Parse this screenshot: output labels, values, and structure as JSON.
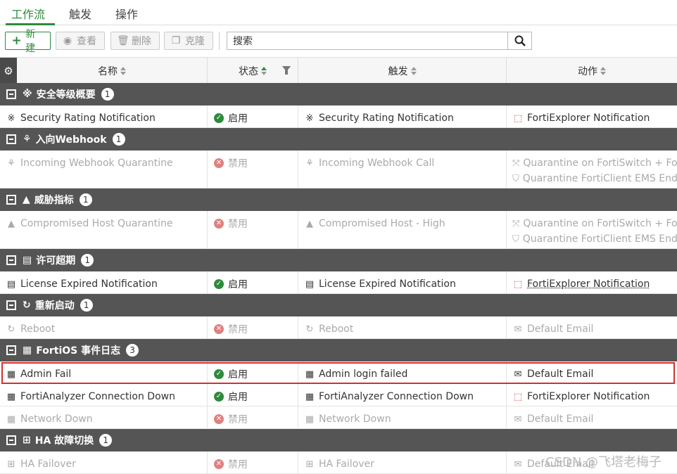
{
  "tabs": [
    "工作流",
    "触发",
    "操作"
  ],
  "toolbar": {
    "new": "新建",
    "view": "查看",
    "delete": "删除",
    "clone": "克隆",
    "search_placeholder": "搜索"
  },
  "columns": [
    "名称",
    "状态",
    "触发",
    "动作"
  ],
  "groups": [
    {
      "label": "安全等级概要",
      "count": "1",
      "icon": "security-rating-icon"
    },
    {
      "label": "入向Webhook",
      "count": "1",
      "icon": "webhook-icon"
    },
    {
      "label": "威胁指标",
      "count": "1",
      "icon": "warning-icon"
    },
    {
      "label": "许可超期",
      "count": "1",
      "icon": "license-icon"
    },
    {
      "label": "重新启动",
      "count": "1",
      "icon": "reboot-icon"
    },
    {
      "label": "FortiOS 事件日志",
      "count": "3",
      "icon": "event-log-icon"
    },
    {
      "label": "HA 故障切换",
      "count": "1",
      "icon": "ha-icon"
    }
  ],
  "rows": [
    {
      "name": "Security Rating Notification",
      "status": "启用",
      "trigger": "Security Rating Notification",
      "actions": [
        "FortiExplorer Notification"
      ]
    },
    {
      "name": "Incoming Webhook Quarantine",
      "status": "禁用",
      "trigger": "Incoming Webhook Call",
      "actions": [
        "Quarantine on FortiSwitch + FortiAP",
        "Quarantine FortiClient EMS Endpoint"
      ]
    },
    {
      "name": "Compromised Host Quarantine",
      "status": "禁用",
      "trigger": "Compromised Host - High",
      "actions": [
        "Quarantine on FortiSwitch + FortiAP",
        "Quarantine FortiClient EMS Endpoint"
      ]
    },
    {
      "name": "License Expired Notification",
      "status": "启用",
      "trigger": "License Expired Notification",
      "actions": [
        "FortiExplorer Notification"
      ]
    },
    {
      "name": "Reboot",
      "status": "禁用",
      "trigger": "Reboot",
      "actions": [
        "Default Email"
      ]
    },
    {
      "name": "Admin Fail",
      "status": "启用",
      "trigger": "Admin login failed",
      "actions": [
        "Default Email"
      ]
    },
    {
      "name": "FortiAnalyzer Connection Down",
      "status": "启用",
      "trigger": "FortiAnalyzer Connection Down",
      "actions": [
        "FortiExplorer Notification"
      ]
    },
    {
      "name": "Network Down",
      "status": "禁用",
      "trigger": "Network Down",
      "actions": [
        "Default Email"
      ]
    },
    {
      "name": "HA Failover",
      "status": "禁用",
      "trigger": "HA Failover",
      "actions": [
        "Default Email"
      ]
    }
  ],
  "watermark": "CSDN @飞塔老梅子"
}
